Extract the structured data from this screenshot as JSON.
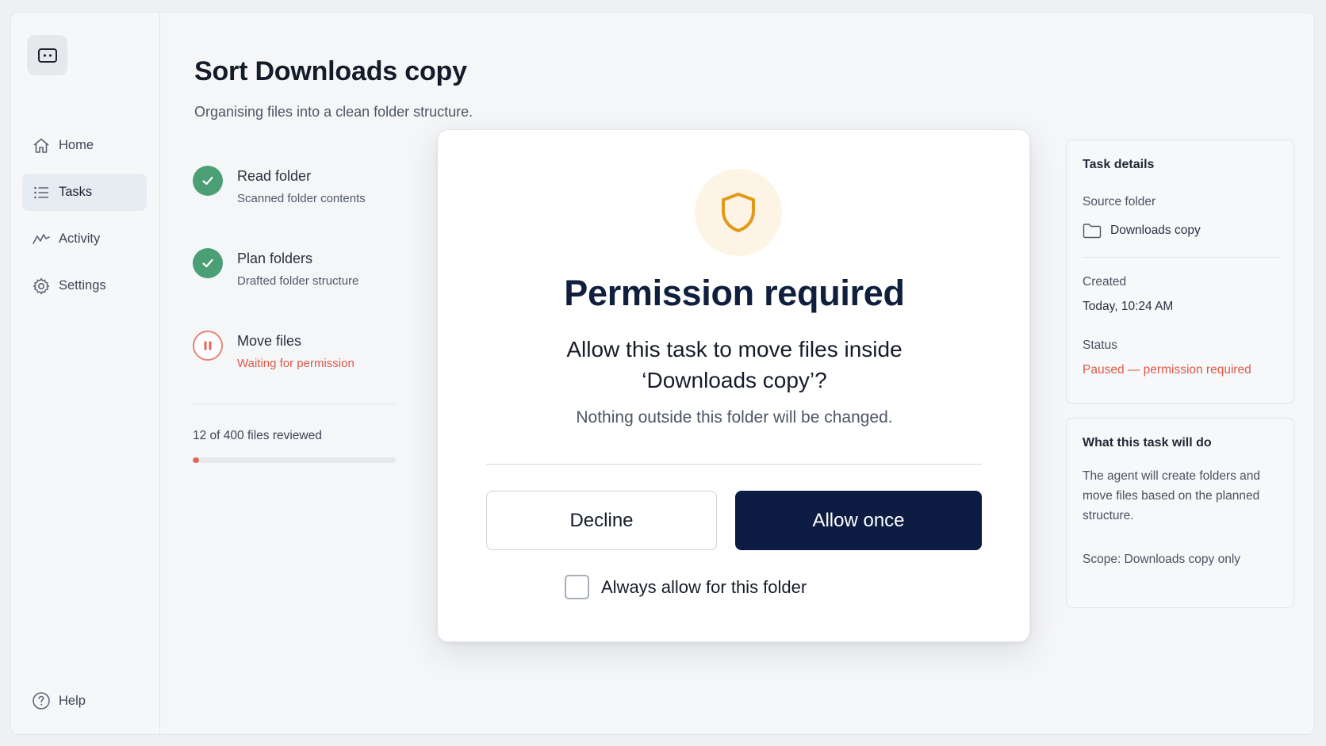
{
  "sidebar": {
    "items": [
      {
        "label": "Home",
        "icon": "home-icon",
        "active": false
      },
      {
        "label": "Tasks",
        "icon": "list-icon",
        "active": true
      },
      {
        "label": "Activity",
        "icon": "activity-icon",
        "active": false
      },
      {
        "label": "Settings",
        "icon": "gear-icon",
        "active": false
      }
    ],
    "help_label": "Help"
  },
  "main": {
    "title": "Sort Downloads copy",
    "subtitle": "Organising files into a clean folder structure.",
    "steps": [
      {
        "label": "Read folder",
        "sub": "Scanned folder contents",
        "state": "done"
      },
      {
        "label": "Plan folders",
        "sub": "Drafted folder structure",
        "state": "done"
      },
      {
        "label": "Move files",
        "sub": "Waiting for permission",
        "state": "paused"
      }
    ],
    "progress": {
      "text": "12 of 400 files reviewed",
      "reviewed": 12,
      "total": 400
    }
  },
  "details": {
    "title": "Task details",
    "source_label": "Source folder",
    "source_value": "Downloads copy",
    "created_label": "Created",
    "created_value": "Today, 10:24 AM",
    "status_label": "Status",
    "status_value": "Paused — permission required"
  },
  "scope": {
    "title": "What this task will do",
    "description": "The agent will create folders and move files based on the planned structure.",
    "scope_text": "Scope: Downloads copy only"
  },
  "dialog": {
    "title": "Permission required",
    "body": "Allow this task to move files inside ‘Downloads copy’?",
    "note": "Nothing outside this folder will be changed.",
    "decline_label": "Decline",
    "allow_label": "Allow once",
    "always_allow_label": "Always allow for this folder",
    "always_allow_checked": false
  },
  "colors": {
    "accent": "#0c1c42",
    "success": "#4aa074",
    "warning": "#dd5a48",
    "shield": "#e09a1a"
  }
}
